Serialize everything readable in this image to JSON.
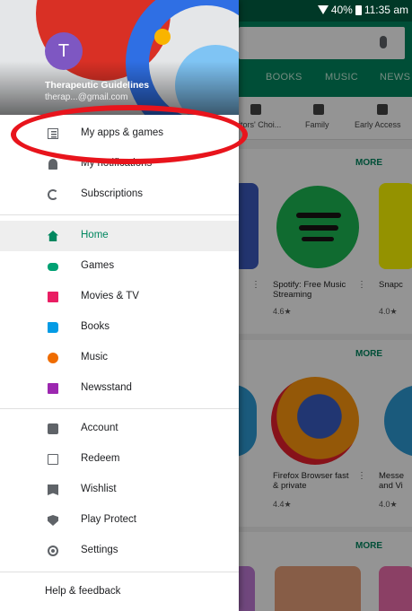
{
  "status_bar": {
    "battery": "40%",
    "time": "11:35 am"
  },
  "background": {
    "tabs": [
      "BOOKS",
      "MUSIC",
      "NEWS"
    ],
    "categories": [
      "itors' Choi...",
      "Family",
      "Early Access"
    ],
    "more_label": "MORE",
    "apps_row1": [
      {
        "title": "Spotify: Free Music Streaming",
        "rating": "4.6★"
      },
      {
        "title": "Snapc",
        "rating": "4.0★"
      }
    ],
    "apps_row2": [
      {
        "title": "Firefox Browser fast & private",
        "rating": "4.4★"
      },
      {
        "title": "Messe and Vi",
        "rating": "4.0★"
      }
    ]
  },
  "drawer": {
    "avatar_letter": "T",
    "account_name": "Therapeutic Guidelines",
    "account_email": "therap...@gmail.com",
    "items": [
      {
        "label": "My apps & games",
        "icon": "apps-grid-icon"
      },
      {
        "label": "My notifications",
        "icon": "bell-icon"
      },
      {
        "label": "Subscriptions",
        "icon": "sync-icon"
      },
      {
        "label": "Home",
        "icon": "home-icon",
        "active": true
      },
      {
        "label": "Games",
        "icon": "gamepad-icon"
      },
      {
        "label": "Movies & TV",
        "icon": "film-icon"
      },
      {
        "label": "Books",
        "icon": "book-icon"
      },
      {
        "label": "Music",
        "icon": "music-icon"
      },
      {
        "label": "Newsstand",
        "icon": "newsstand-icon"
      },
      {
        "label": "Account",
        "icon": "account-icon"
      },
      {
        "label": "Redeem",
        "icon": "redeem-icon"
      },
      {
        "label": "Wishlist",
        "icon": "wishlist-icon"
      },
      {
        "label": "Play Protect",
        "icon": "shield-icon"
      },
      {
        "label": "Settings",
        "icon": "gear-icon"
      }
    ],
    "help_label": "Help & feedback"
  },
  "colors": {
    "play_green": "#01875f",
    "annotation_red": "#e8141c"
  }
}
